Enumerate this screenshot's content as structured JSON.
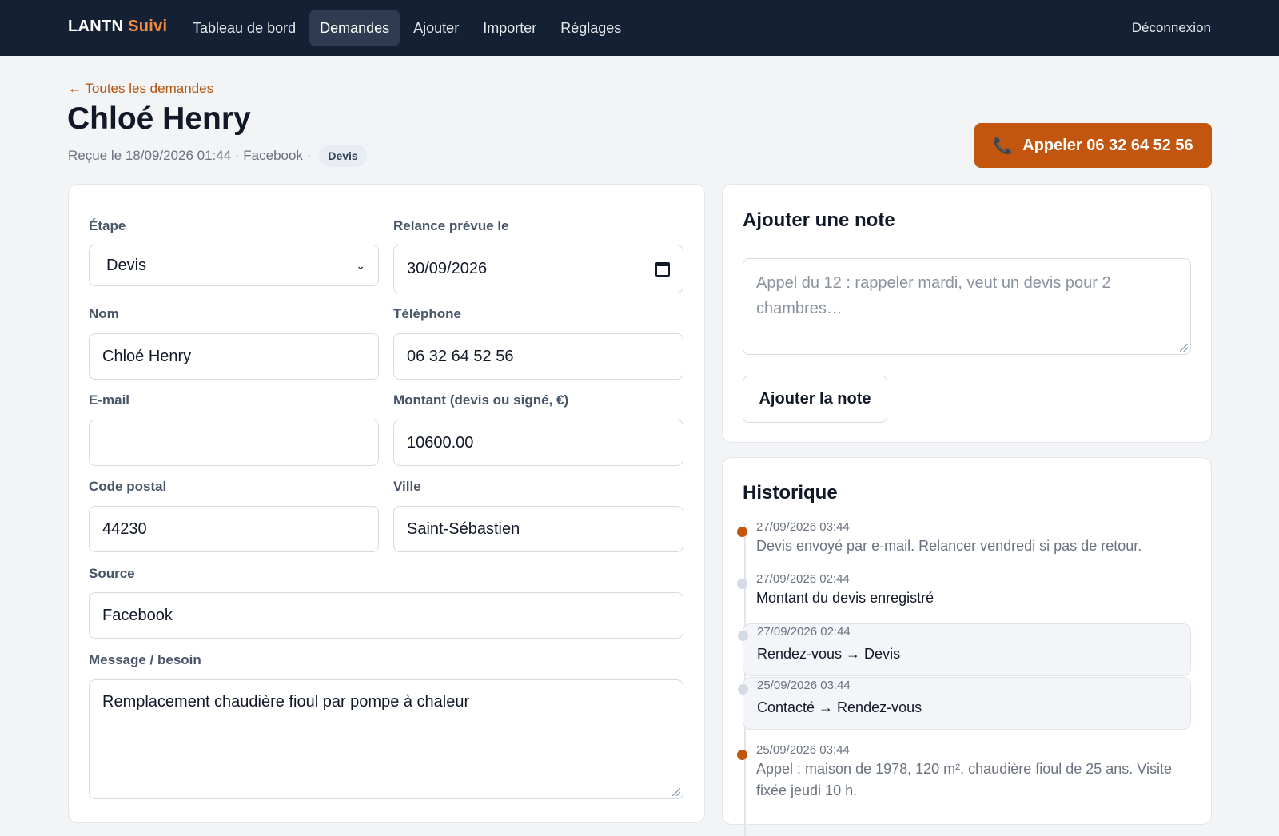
{
  "nav": {
    "brand_main": "LANTN",
    "brand_accent": "Suivi",
    "items": [
      {
        "label": "Tableau de bord"
      },
      {
        "label": "Demandes"
      },
      {
        "label": "Ajouter"
      },
      {
        "label": "Importer"
      },
      {
        "label": "Réglages"
      }
    ],
    "logout": "Déconnexion"
  },
  "header": {
    "back_link": "← Toutes les demandes",
    "title": "Chloé Henry",
    "meta": "Reçue le 18/09/2026 01:44 · Facebook ·",
    "badge": "Devis",
    "call_icon": "📞",
    "call_label": "Appeler 06 32 64 52 56"
  },
  "form": {
    "etape": {
      "label": "Étape",
      "value": "Devis",
      "chevron": "⌄"
    },
    "relance": {
      "label": "Relance prévue le",
      "value": "30/09/2026"
    },
    "nom": {
      "label": "Nom",
      "value": "Chloé Henry"
    },
    "telephone": {
      "label": "Téléphone",
      "value": "06 32 64 52 56"
    },
    "email": {
      "label": "E-mail",
      "value": ""
    },
    "montant": {
      "label": "Montant (devis ou signé, €)",
      "value": "10600.00"
    },
    "code_postal": {
      "label": "Code postal",
      "value": "44230"
    },
    "ville": {
      "label": "Ville",
      "value": "Saint-Sébastien"
    },
    "source": {
      "label": "Source",
      "value": "Facebook"
    },
    "message": {
      "label": "Message / besoin",
      "value": "Remplacement chaudière fioul par pompe à chaleur"
    }
  },
  "note": {
    "title": "Ajouter une note",
    "placeholder": "Appel du 12 : rappeler mardi, veut un devis pour 2 chambres…",
    "button": "Ajouter la note"
  },
  "history": {
    "title": "Historique",
    "entries": [
      {
        "time": "27/09/2026 03:44",
        "text": "Devis envoyé par e-mail. Relancer vendredi si pas de retour."
      },
      {
        "time": "27/09/2026 02:44",
        "text": "Montant du devis enregistré"
      },
      {
        "time": "27/09/2026 02:44",
        "text": "Rendez-vous → Devis"
      },
      {
        "time": "25/09/2026 03:44",
        "text": "Contacté → Rendez-vous"
      },
      {
        "time": "25/09/2026 03:44",
        "text": "Appel : maison de 1978, 120 m², chaudière fioul de 25 ans. Visite fixée jeudi 10 h."
      }
    ]
  },
  "colors": {
    "nav_bg": "#142033",
    "accent": "#c2560f",
    "brand_accent": "#f08c43"
  }
}
